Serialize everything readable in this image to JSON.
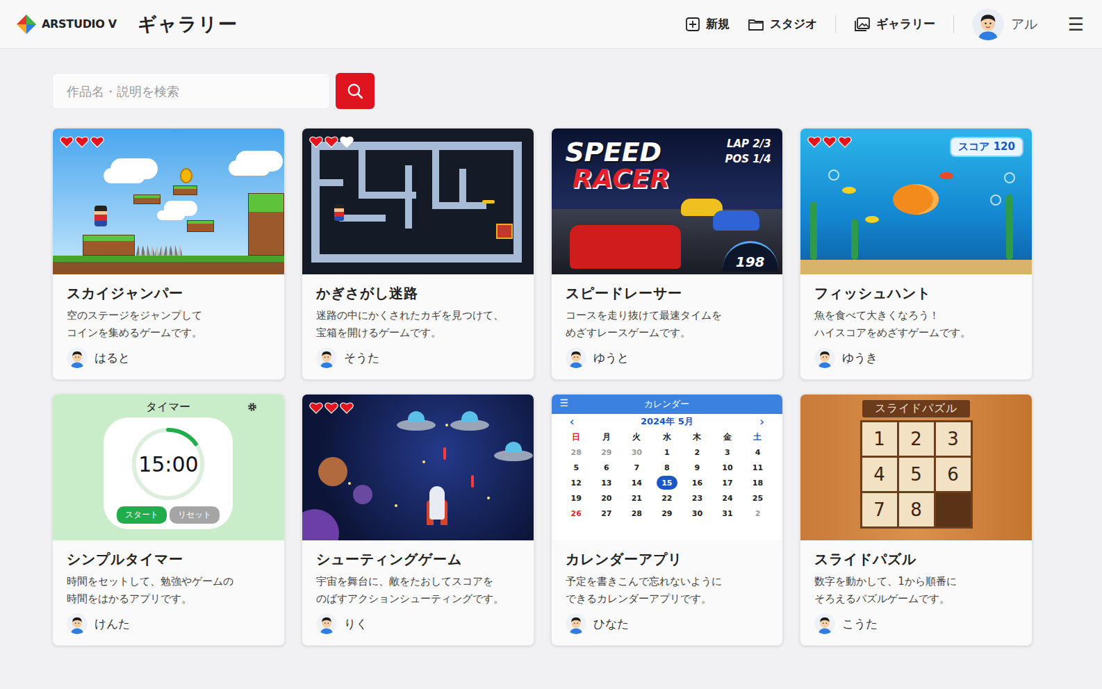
{
  "header": {
    "logo": "ARSTUDIO V",
    "title": "ギャラリー",
    "nav": [
      {
        "label": "新規",
        "kind": "new"
      },
      {
        "label": "スタジオ",
        "kind": "studio"
      },
      {
        "label": "ギャラリー",
        "kind": "gallery"
      }
    ],
    "user": {
      "name": "アル"
    },
    "menu": "☰"
  },
  "search": {
    "placeholder": "作品名・説明を検索"
  },
  "works": [
    {
      "title": "スカイジャンパー",
      "description": [
        "空のステージをジャンプして",
        "コインを集めるゲームです。"
      ],
      "author": "はると",
      "thumb": {
        "kind": "platformer",
        "hearts": [
          {
            "filled": true
          },
          {
            "filled": true
          },
          {
            "filled": true
          }
        ]
      }
    },
    {
      "title": "かぎさがし迷路",
      "description": [
        "迷路の中にかくされたカギを見つけて、",
        "宝箱を開けるゲームです。"
      ],
      "author": "そうた",
      "thumb": {
        "kind": "maze",
        "hearts": [
          {
            "filled": true
          },
          {
            "filled": true
          },
          {
            "filled": false
          }
        ]
      }
    },
    {
      "title": "スピードレーサー",
      "description": [
        "コースを走り抜けて最速タイムを",
        "めざすレースゲームです。"
      ],
      "author": "ゆうと",
      "thumb": {
        "kind": "racer",
        "logo": [
          "SPEED",
          "RACER"
        ],
        "lap": "LAP 2/3",
        "pos": "POS 1/4",
        "speed": "198"
      }
    },
    {
      "title": "フィッシュハント",
      "description": [
        "魚を食べて大きくなろう！",
        "ハイスコアをめざすゲームです。"
      ],
      "author": "ゆうき",
      "thumb": {
        "kind": "aquarium",
        "hearts": [
          {
            "filled": true
          },
          {
            "filled": true
          },
          {
            "filled": true
          }
        ],
        "score": "スコア 120"
      }
    },
    {
      "title": "シンプルタイマー",
      "description": [
        "時間をセットして、勉強やゲームの",
        "時間をはかるアプリです。"
      ],
      "author": "けんた",
      "thumb": {
        "kind": "timer",
        "title": "タイマー",
        "time": "15:00",
        "level": 0.15,
        "buttons": [
          {
            "label": "スタート",
            "kind": "start"
          },
          {
            "label": "リセット",
            "kind": "reset"
          }
        ]
      }
    },
    {
      "title": "シューティングゲーム",
      "description": [
        "宇宙を舞台に、敵をたおしてスコアを",
        "のばすアクションシューティングです。"
      ],
      "author": "りく",
      "thumb": {
        "kind": "space",
        "hearts": [
          {
            "filled": true
          },
          {
            "filled": true
          },
          {
            "filled": true
          }
        ]
      }
    },
    {
      "title": "カレンダーアプリ",
      "description": [
        "予定を書きこんで忘れないように",
        "できるカレンダーアプリです。"
      ],
      "author": "ひなた",
      "thumb": {
        "kind": "calendar",
        "menu": "☰",
        "title": "カレンダー",
        "prev": "‹",
        "month": "2024年 5月",
        "next": "›",
        "weekdays": [
          {
            "label": "日",
            "color": "#e0262b"
          },
          {
            "label": "月",
            "color": "#222222"
          },
          {
            "label": "火",
            "color": "#222222"
          },
          {
            "label": "水",
            "color": "#222222"
          },
          {
            "label": "木",
            "color": "#222222"
          },
          {
            "label": "金",
            "color": "#222222"
          },
          {
            "label": "土",
            "color": "#1a56c8"
          }
        ],
        "weeks": [
          [
            {
              "d": "28",
              "muted": true,
              "holiday": false,
              "selected": false
            },
            {
              "d": "29",
              "muted": true,
              "holiday": false,
              "selected": false
            },
            {
              "d": "30",
              "muted": true,
              "holiday": false,
              "selected": false
            },
            {
              "d": "1",
              "muted": false,
              "holiday": false,
              "selected": false
            },
            {
              "d": "2",
              "muted": false,
              "holiday": false,
              "selected": false
            },
            {
              "d": "3",
              "muted": false,
              "holiday": false,
              "selected": false
            },
            {
              "d": "4",
              "muted": false,
              "holiday": false,
              "selected": false
            }
          ],
          [
            {
              "d": "5",
              "muted": false,
              "holiday": false,
              "selected": false
            },
            {
              "d": "6",
              "muted": false,
              "holiday": false,
              "selected": false
            },
            {
              "d": "7",
              "muted": false,
              "holiday": false,
              "selected": false
            },
            {
              "d": "8",
              "muted": false,
              "holiday": false,
              "selected": false
            },
            {
              "d": "9",
              "muted": false,
              "holiday": false,
              "selected": false
            },
            {
              "d": "10",
              "muted": false,
              "holiday": false,
              "selected": false
            },
            {
              "d": "11",
              "muted": false,
              "holiday": false,
              "selected": false
            }
          ],
          [
            {
              "d": "12",
              "muted": false,
              "holiday": false,
              "selected": false
            },
            {
              "d": "13",
              "muted": false,
              "holiday": false,
              "selected": false
            },
            {
              "d": "14",
              "muted": false,
              "holiday": false,
              "selected": false
            },
            {
              "d": "15",
              "muted": false,
              "holiday": false,
              "selected": true
            },
            {
              "d": "16",
              "muted": false,
              "holiday": false,
              "selected": false
            },
            {
              "d": "17",
              "muted": false,
              "holiday": false,
              "selected": false
            },
            {
              "d": "18",
              "muted": false,
              "holiday": false,
              "selected": false
            }
          ],
          [
            {
              "d": "19",
              "muted": false,
              "holiday": false,
              "selected": false
            },
            {
              "d": "20",
              "muted": false,
              "holiday": false,
              "selected": false
            },
            {
              "d": "21",
              "muted": false,
              "holiday": false,
              "selected": false
            },
            {
              "d": "22",
              "muted": false,
              "holiday": false,
              "selected": false
            },
            {
              "d": "23",
              "muted": false,
              "holiday": false,
              "selected": false
            },
            {
              "d": "24",
              "muted": false,
              "holiday": false,
              "selected": false
            },
            {
              "d": "25",
              "muted": false,
              "holiday": false,
              "selected": false
            }
          ],
          [
            {
              "d": "26",
              "muted": false,
              "holiday": true,
              "selected": false
            },
            {
              "d": "27",
              "muted": false,
              "holiday": false,
              "selected": false
            },
            {
              "d": "28",
              "muted": false,
              "holiday": false,
              "selected": false
            },
            {
              "d": "29",
              "muted": false,
              "holiday": false,
              "selected": false
            },
            {
              "d": "30",
              "muted": false,
              "holiday": false,
              "selected": false
            },
            {
              "d": "31",
              "muted": false,
              "holiday": false,
              "selected": false
            },
            {
              "d": "2",
              "muted": true,
              "holiday": false,
              "selected": false
            }
          ]
        ]
      }
    },
    {
      "title": "スライドパズル",
      "description": [
        "数字を動かして、1から順番に",
        "そろえるパズルゲームです。"
      ],
      "author": "こうた",
      "thumb": {
        "kind": "puzzle",
        "title": "スライドパズル",
        "tiles": [
          {
            "label": "1",
            "empty": false
          },
          {
            "label": "2",
            "empty": false
          },
          {
            "label": "3",
            "empty": false
          },
          {
            "label": "4",
            "empty": false
          },
          {
            "label": "5",
            "empty": false
          },
          {
            "label": "6",
            "empty": false
          },
          {
            "label": "7",
            "empty": false
          },
          {
            "label": "8",
            "empty": false
          },
          {
            "label": "",
            "empty": true
          }
        ]
      }
    }
  ]
}
